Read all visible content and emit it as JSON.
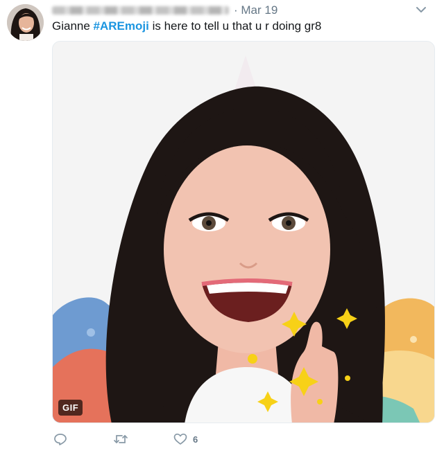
{
  "tweet": {
    "date": "· Mar 19",
    "text_plain_1": "Gianne ",
    "hashtag": "#AREmoji",
    "text_plain_2": " is here to tell u that u r doing gr8",
    "media_badge": "GIF",
    "likes": "6"
  },
  "icons": {
    "reply": "reply-icon",
    "retweet": "retweet-icon",
    "like": "heart-icon",
    "more": "chevron-down-icon"
  },
  "colors": {
    "link": "#1b95e0",
    "muted": "#657786"
  }
}
